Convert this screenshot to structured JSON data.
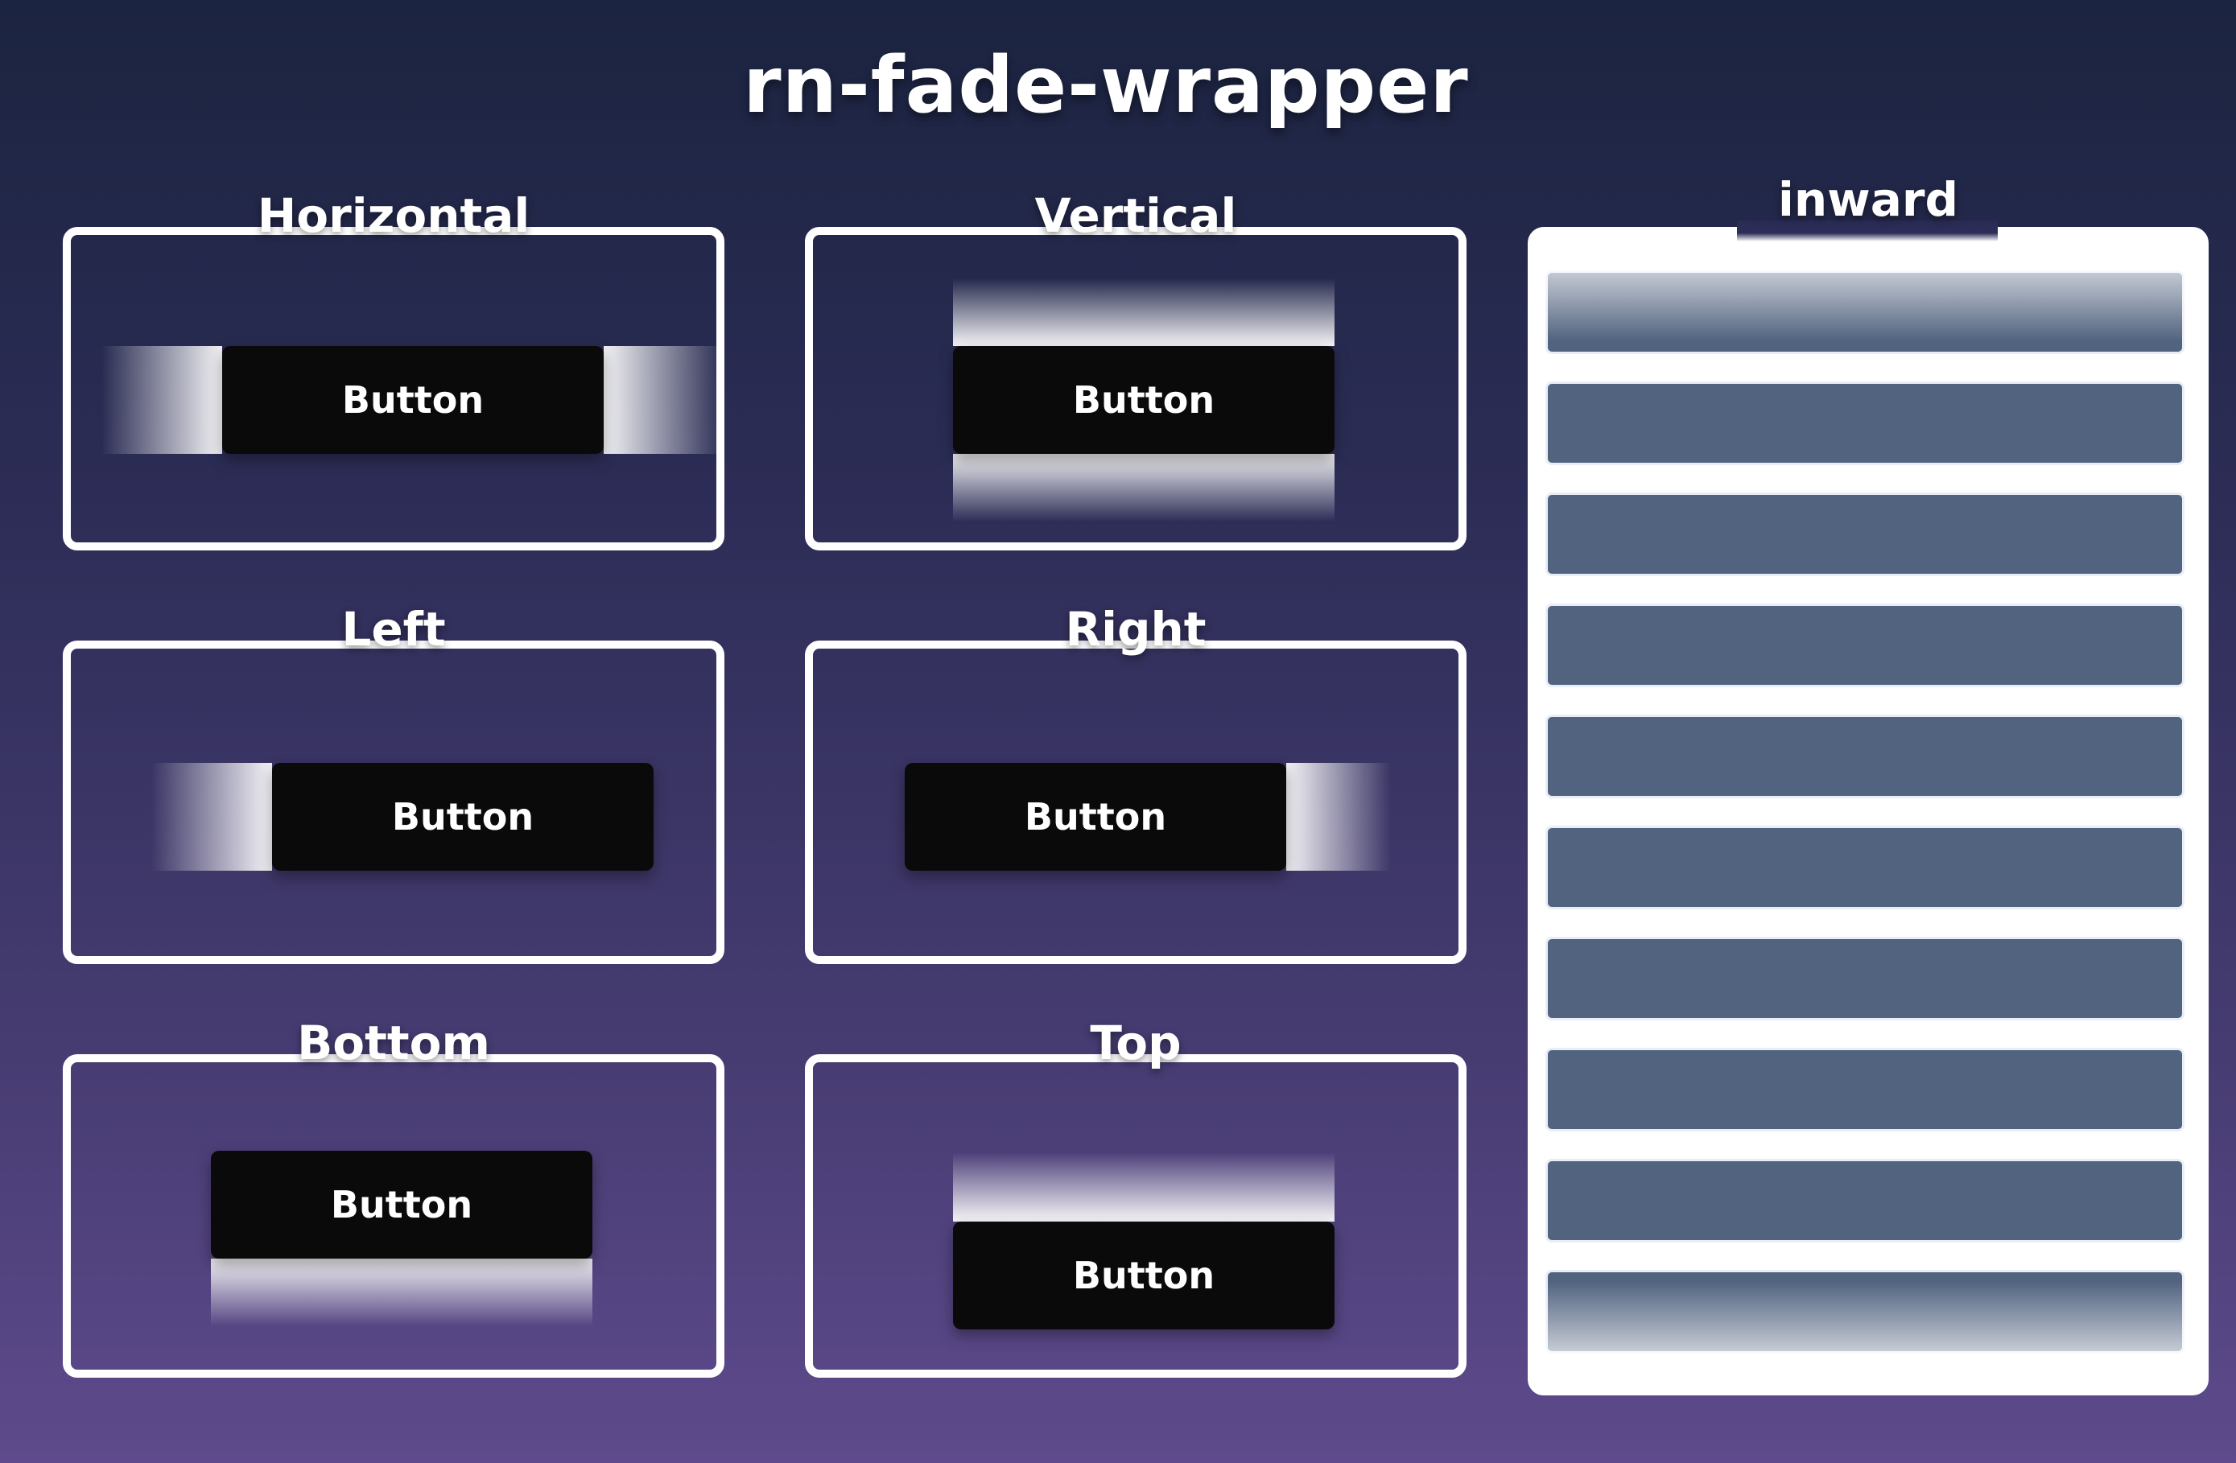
{
  "title": "rn-fade-wrapper",
  "cards": {
    "horizontal": {
      "label": "Horizontal",
      "button": "Button"
    },
    "vertical": {
      "label": "Vertical",
      "button": "Button"
    },
    "left": {
      "label": "Left",
      "button": "Button"
    },
    "right": {
      "label": "Right",
      "button": "Button"
    },
    "bottom": {
      "label": "Bottom",
      "button": "Button"
    },
    "top": {
      "label": "Top",
      "button": "Button"
    }
  },
  "inward": {
    "label": "inward",
    "items": [
      "",
      "",
      "",
      "",
      "",
      "",
      "",
      "",
      "",
      ""
    ]
  },
  "colors": {
    "background_top": "#1b2440",
    "background_bottom": "#5e4a8c",
    "button": "#0a0a0a",
    "list_item": "#51637f",
    "fade": "#ffffff"
  }
}
